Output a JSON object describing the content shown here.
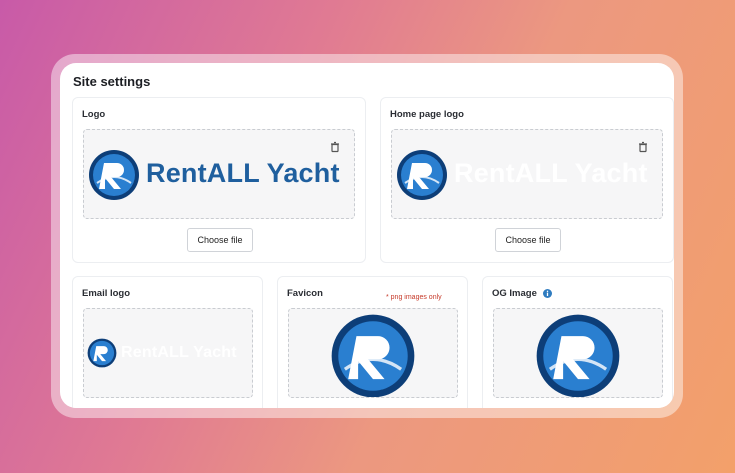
{
  "panel": {
    "title": "Site settings"
  },
  "cards": {
    "logo": {
      "label": "Logo",
      "brand_text": "RentALL Yacht",
      "button": "Choose file"
    },
    "home_logo": {
      "label": "Home page logo",
      "brand_text": "RentALL Yacht",
      "button": "Choose file"
    },
    "email_logo": {
      "label": "Email logo",
      "brand_text": "RentALL Yacht"
    },
    "favicon": {
      "label": "Favicon",
      "note": "* png images only"
    },
    "og_image": {
      "label": "OG Image"
    }
  },
  "colors": {
    "brand_blue": "#1f5f9e",
    "logo_dark": "#0d3e78",
    "logo_mid": "#2a7fd0",
    "note_red": "#c63b2b",
    "info_blue": "#2f7cc0"
  },
  "icons": [
    "trash-icon",
    "info-icon",
    "yacht-logo-icon"
  ]
}
